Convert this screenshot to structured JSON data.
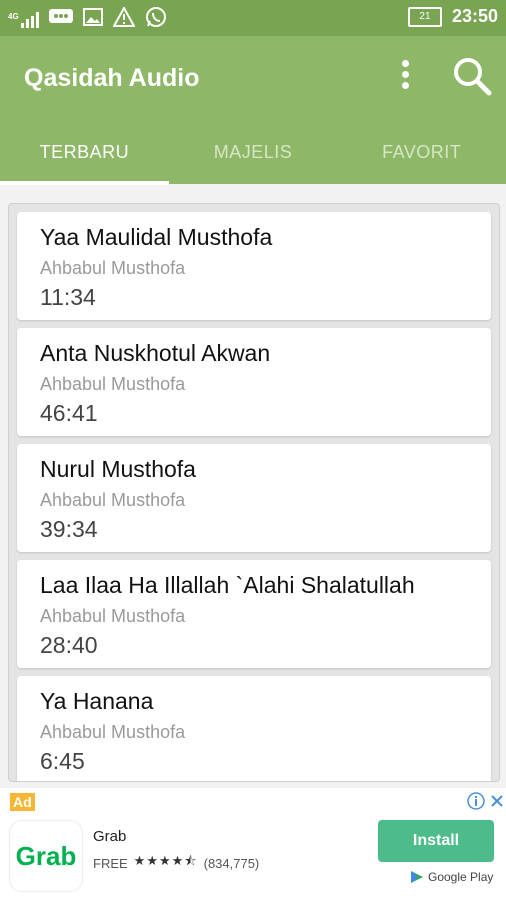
{
  "status_bar": {
    "network": "4G",
    "battery": "21",
    "time": "23:50"
  },
  "app_bar": {
    "title": "Qasidah Audio",
    "icons": [
      "more-vert-icon",
      "search-icon"
    ]
  },
  "tabs": [
    {
      "label": "TERBARU",
      "active": true
    },
    {
      "label": "MAJELIS",
      "active": false
    },
    {
      "label": "FAVORIT",
      "active": false
    }
  ],
  "tracks": [
    {
      "title": "Yaa Maulidal Musthofa",
      "artist": "Ahbabul Musthofa",
      "duration": "11:34"
    },
    {
      "title": "Anta Nuskhotul Akwan",
      "artist": "Ahbabul Musthofa",
      "duration": "46:41"
    },
    {
      "title": "Nurul Musthofa",
      "artist": "Ahbabul Musthofa",
      "duration": "39:34"
    },
    {
      "title": "Laa Ilaa Ha Illallah `Alahi Shalatullah",
      "artist": "Ahbabul Musthofa",
      "duration": "28:40"
    },
    {
      "title": "Ya Hanana",
      "artist": "Ahbabul Musthofa",
      "duration": "6:45"
    }
  ],
  "ad": {
    "badge": "Ad",
    "logo_text": "Grab",
    "app_name": "Grab",
    "price": "FREE",
    "stars": "★★★★⯪",
    "rating_count": "(834,775)",
    "install_label": "Install",
    "store_label": "Google Play"
  },
  "colors": {
    "status_bar": "#79a452",
    "app_bar": "#8eb767",
    "install": "#4dbb8a",
    "grab_green": "#00b14f"
  }
}
